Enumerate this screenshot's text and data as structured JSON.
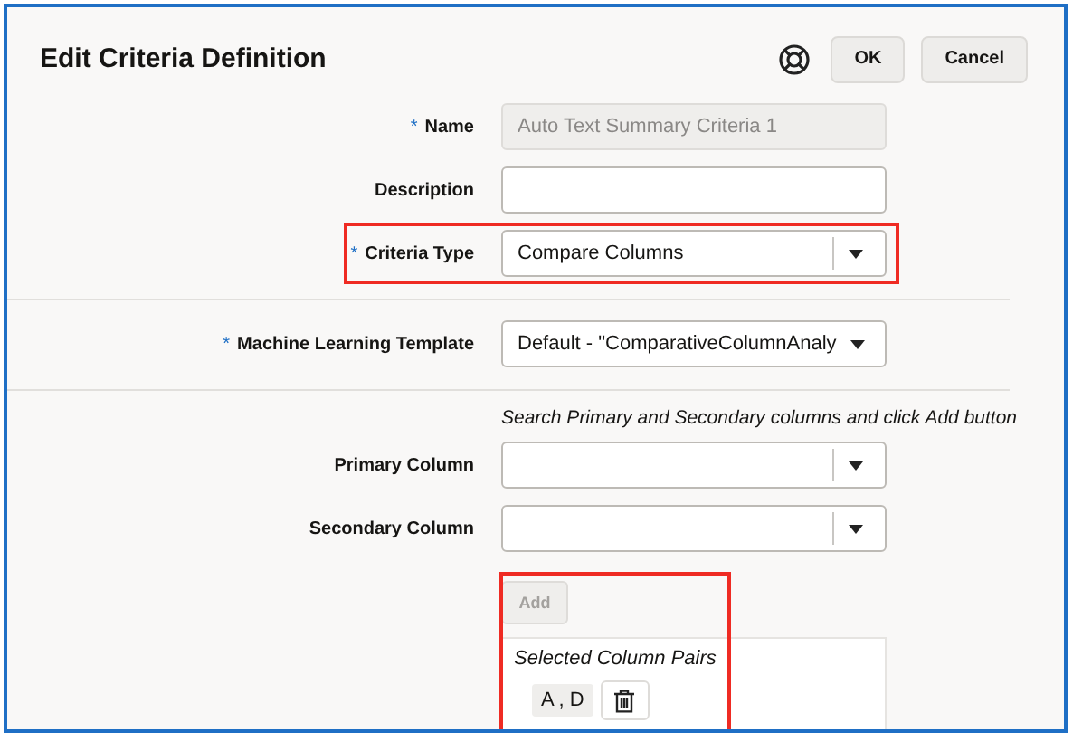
{
  "dialog": {
    "title": "Edit Criteria Definition",
    "buttons": [
      {
        "label": "OK"
      },
      {
        "label": "Cancel"
      }
    ]
  },
  "sections": [
    {
      "fields": [
        {
          "label": "Name",
          "required_mark": "*",
          "kind": "text",
          "value": "Auto Text Summary Criteria 1",
          "disabled": true,
          "highlighted": false
        },
        {
          "label": "Description",
          "kind": "text",
          "disabled": false,
          "highlighted": false
        },
        {
          "label": "Criteria Type",
          "required_mark": "*",
          "kind": "combobox",
          "value": "Compare Columns",
          "disabled": false,
          "highlighted": true
        }
      ]
    },
    {
      "fields": [
        {
          "label": "Machine Learning Template",
          "required_mark": "*",
          "kind": "select",
          "value": "Default - \"ComparativeColumnAnaly",
          "disabled": false,
          "highlighted": false
        }
      ]
    },
    {
      "hint": "Search Primary and Secondary columns and click Add button",
      "fields": [
        {
          "label": "Primary Column",
          "kind": "combobox",
          "disabled": false,
          "highlighted": false
        },
        {
          "label": "Secondary Column",
          "kind": "combobox",
          "disabled": false,
          "highlighted": false
        }
      ]
    }
  ],
  "add_button": {
    "label": "Add",
    "disabled": true
  },
  "add_area_highlighted": true,
  "selected_pairs": {
    "title": "Selected Column Pairs",
    "pairs": [
      {
        "label": "A , D"
      }
    ]
  }
}
